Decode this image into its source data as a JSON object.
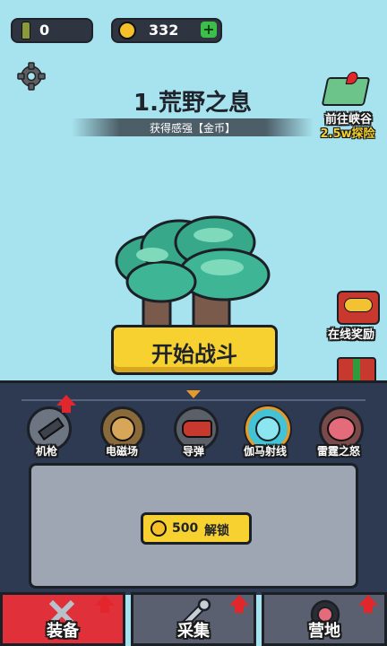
{
  "hud": {
    "ammo_icon": "bullet-icon",
    "ammo_value": "0",
    "coin_icon": "coin-icon",
    "coin_value": "332",
    "add_icon": "plus-icon"
  },
  "level": {
    "title": "1.荒野之息",
    "subtitle": "获得感强【金币】"
  },
  "goto": {
    "label": "前往峡谷",
    "sub": "2.5w探险"
  },
  "online_reward": {
    "label": "在线奖励"
  },
  "start_button": {
    "label": "开始战斗"
  },
  "weapons": [
    {
      "name": "机枪",
      "icon": "machine-gun-icon",
      "upgrade": true
    },
    {
      "name": "电磁场",
      "icon": "electromagnetic-icon",
      "upgrade": false
    },
    {
      "name": "导弹",
      "icon": "missile-icon",
      "upgrade": false
    },
    {
      "name": "伽马射线",
      "icon": "gamma-ray-icon",
      "upgrade": false,
      "selected": true
    },
    {
      "name": "雷霆之怒",
      "icon": "thunder-pig-icon",
      "upgrade": false
    }
  ],
  "unlock": {
    "cost": "500",
    "label": "解锁"
  },
  "tabs": [
    {
      "label": "装备",
      "icon": "sword-icon",
      "active": true
    },
    {
      "label": "采集",
      "icon": "wrench-icon",
      "active": false
    },
    {
      "label": "营地",
      "icon": "camp-icon",
      "active": false
    }
  ],
  "colors": {
    "sky": "#a7e3ee",
    "panel": "#2d3a52",
    "start_button": "#f6d130",
    "active_tab": "#e0303a"
  }
}
